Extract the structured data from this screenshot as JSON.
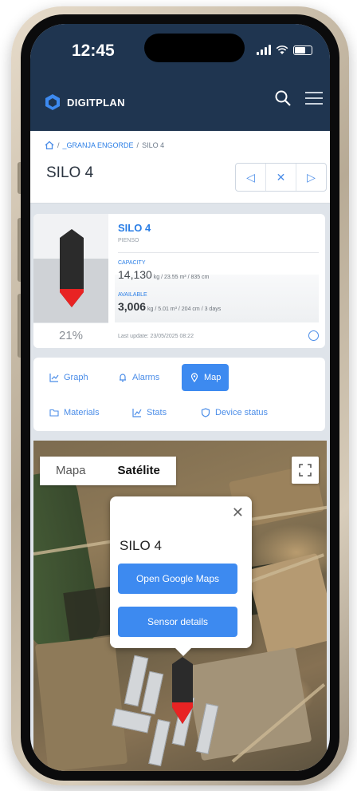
{
  "status_bar": {
    "time": "12:45"
  },
  "app_header": {
    "brand": "DIGITPLAN"
  },
  "breadcrumb": {
    "sep1": "/",
    "farm": "_GRANJA ENGORDE",
    "sep2": "/",
    "current": "SILO 4"
  },
  "page": {
    "title": "SILO 4"
  },
  "nav_buttons": {
    "prev": "◁",
    "close": "✕",
    "next": "▷"
  },
  "silo": {
    "name": "SILO 4",
    "product": "PIENSO",
    "fill_percent_label": "21%",
    "fill_fraction": 0.21,
    "capacity_label": "CAPACITY",
    "capacity_value": "14,130",
    "capacity_detail": "kg / 23.55 m³ / 835 cm",
    "available_label": "AVAILABLE",
    "available_value": "3,006",
    "available_detail": "kg / 5.01 m³ / 204 cm / 3 days",
    "last_update": "Last update: 23/05/2025 08:22"
  },
  "tabs": [
    {
      "label": "Graph",
      "icon": "chart-icon"
    },
    {
      "label": "Alarms",
      "icon": "bell-icon"
    },
    {
      "label": "Map",
      "icon": "map-pin-icon",
      "active": true
    },
    {
      "label": "Materials",
      "icon": "folder-icon"
    },
    {
      "label": "Stats",
      "icon": "stats-icon"
    },
    {
      "label": "Device status",
      "icon": "shield-icon"
    }
  ],
  "map": {
    "type_options": [
      "Mapa",
      "Satélite"
    ],
    "selected_type": "Satélite",
    "popup": {
      "title": "SILO 4",
      "close": "✕",
      "open_maps_button": "Open Google Maps",
      "sensor_button": "Sensor details"
    }
  },
  "colors": {
    "header": "#1f3550",
    "accent": "#3d8af0",
    "silo_body": "#2b2b2b",
    "silo_fill": "#e82323"
  }
}
